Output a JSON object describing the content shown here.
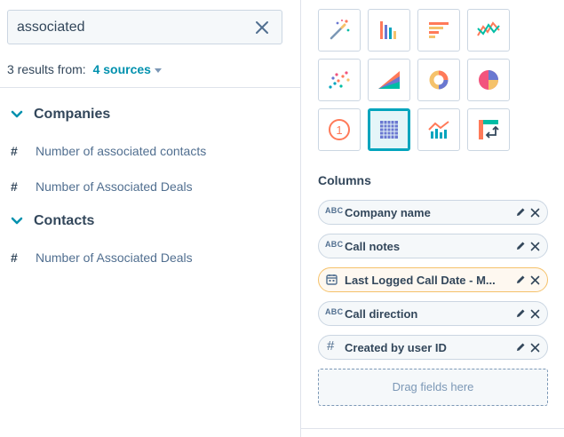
{
  "search": {
    "value": "associated"
  },
  "results": {
    "prefix": "3 results from:",
    "sources": "4 sources"
  },
  "groups": [
    {
      "label": "Companies",
      "fields": [
        "Number of associated contacts",
        "Number of Associated Deals"
      ]
    },
    {
      "label": "Contacts",
      "fields": [
        "Number of Associated Deals"
      ]
    }
  ],
  "viz_types": [
    "magic-wand",
    "vertical-bar",
    "horizontal-bar",
    "line",
    "scatter",
    "area",
    "donut",
    "pie",
    "kpi",
    "table",
    "combo",
    "pivot"
  ],
  "viz_active": "table",
  "kpi_number": "1",
  "columns": {
    "title": "Columns",
    "items": [
      {
        "type": "ABC",
        "label": "Company name",
        "warn": false
      },
      {
        "type": "ABC",
        "label": "Call notes",
        "warn": false
      },
      {
        "type": "calendar",
        "label": "Last Logged Call Date - M...",
        "warn": true
      },
      {
        "type": "ABC",
        "label": "Call direction",
        "warn": false
      },
      {
        "type": "#",
        "label": "Created by user ID",
        "warn": false
      }
    ],
    "dropzone": "Drag fields here"
  },
  "colors": {
    "accent": "#00a4bd",
    "link": "#0091ae",
    "text": "#33475b"
  }
}
